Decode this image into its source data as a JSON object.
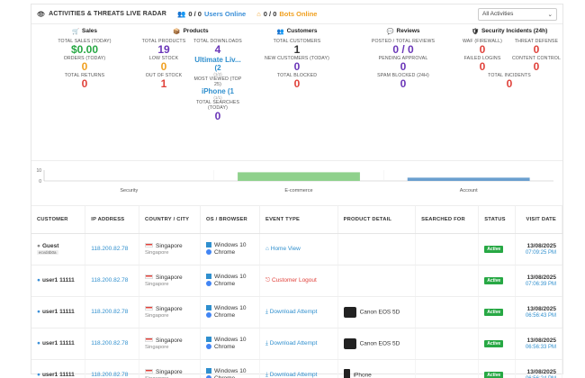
{
  "header": {
    "title": "ACTIVITIES & THREATS LIVE RADAR",
    "users_count": "0 / 0",
    "users_label": "Users Online",
    "bots_count": "0 / 0",
    "bots_label": "Bots Online",
    "filter_value": "All Activities"
  },
  "sales": {
    "title": "Sales",
    "total_sales_label": "TOTAL SALES (TODAY)",
    "total_sales": "$0.00",
    "orders_label": "ORDERS (TODAY)",
    "orders": "0",
    "returns_label": "TOTAL RETURNS",
    "returns": "0"
  },
  "products": {
    "title": "Products",
    "total_products_label": "TOTAL PRODUCTS",
    "total_products": "19",
    "low_stock_label": "LOW STOCK",
    "low_stock": "0",
    "out_of_stock_label": "OUT OF STOCK",
    "out_of_stock": "1",
    "total_downloads_label": "TOTAL DOWNLOADS",
    "total_downloads": "4",
    "top_download": "Ultimate Liv... (2",
    "top_download_sub": "(1/2)",
    "most_viewed_label": "MOST VIEWED (TOP 25)",
    "most_viewed": "iPhone (1",
    "most_viewed_sub": "(1/1)",
    "total_searches_label": "TOTAL SEARCHES (TODAY)",
    "total_searches": "0"
  },
  "customers": {
    "title": "Customers",
    "total_label": "TOTAL CUSTOMERS",
    "total": "1",
    "new_label": "NEW CUSTOMERS (TODAY)",
    "new": "0",
    "blocked_label": "TOTAL BLOCKED",
    "blocked": "0"
  },
  "reviews": {
    "title": "Reviews",
    "posted_label": "POSTED / TOTAL REVIEWS",
    "posted": "0 / 0",
    "pending_label": "PENDING APPROVAL",
    "pending": "0",
    "spam_label": "SPAM BLOCKED (24H)",
    "spam": "0"
  },
  "security": {
    "title": "Security Incidents (24h)",
    "waf_label": "WAF (FIREWALL)",
    "waf": "0",
    "threat_label": "THREAT DEFENSE",
    "threat": "0",
    "failed_label": "FAILED LOGINS",
    "failed": "0",
    "content_label": "CONTENT CONTROL",
    "content": "0",
    "total_label": "TOTAL INCIDENTS",
    "total": "0"
  },
  "chart_data": {
    "type": "bar",
    "categories": [
      "Security",
      "E-commerce",
      "Account"
    ],
    "values": [
      0,
      8,
      3
    ],
    "ylim": [
      0,
      10
    ],
    "yticks": [
      "10",
      "0"
    ],
    "colors": [
      "#e0413a",
      "#8fd18c",
      "#6a9fcf"
    ]
  },
  "table": {
    "headers": {
      "customer": "CUSTOMER",
      "ip": "IP ADDRESS",
      "country": "COUNTRY / CITY",
      "os": "OS / BROWSER",
      "event": "EVENT TYPE",
      "product": "PRODUCT DETAIL",
      "searched": "SEARCHED FOR",
      "status": "STATUS",
      "visit": "VISIT DATE"
    },
    "rows": [
      {
        "customer": "Guest",
        "tag": "ecvd4b0a",
        "ip": "118.200.82.78",
        "country": "Singapore",
        "city": "Singapore",
        "os": "Windows 10",
        "browser": "Chrome",
        "event": "Home View",
        "product": "",
        "status": "Active",
        "date": "13/08/2025",
        "time": "07:09:25 PM"
      },
      {
        "customer": "user1 11111",
        "tag": "",
        "ip": "118.200.82.78",
        "country": "Singapore",
        "city": "Singapore",
        "os": "Windows 10",
        "browser": "Chrome",
        "event": "Customer Logout",
        "product": "",
        "status": "Active",
        "date": "13/08/2025",
        "time": "07:06:39 PM"
      },
      {
        "customer": "user1 11111",
        "tag": "",
        "ip": "118.200.82.78",
        "country": "Singapore",
        "city": "Singapore",
        "os": "Windows 10",
        "browser": "Chrome",
        "event": "Download Attempt",
        "product": "Canon EOS 5D",
        "status": "Active",
        "date": "13/08/2025",
        "time": "06:56:43 PM"
      },
      {
        "customer": "user1 11111",
        "tag": "",
        "ip": "118.200.82.78",
        "country": "Singapore",
        "city": "Singapore",
        "os": "Windows 10",
        "browser": "Chrome",
        "event": "Download Attempt",
        "product": "Canon EOS 5D",
        "status": "Active",
        "date": "13/08/2025",
        "time": "06:56:33 PM"
      },
      {
        "customer": "user1 11111",
        "tag": "",
        "ip": "118.200.82.78",
        "country": "Singapore",
        "city": "Singapore",
        "os": "Windows 10",
        "browser": "Chrome",
        "event": "Download Attempt",
        "product": "iPhone",
        "status": "Active",
        "date": "13/08/2025",
        "time": "06:56:24 PM"
      }
    ]
  }
}
